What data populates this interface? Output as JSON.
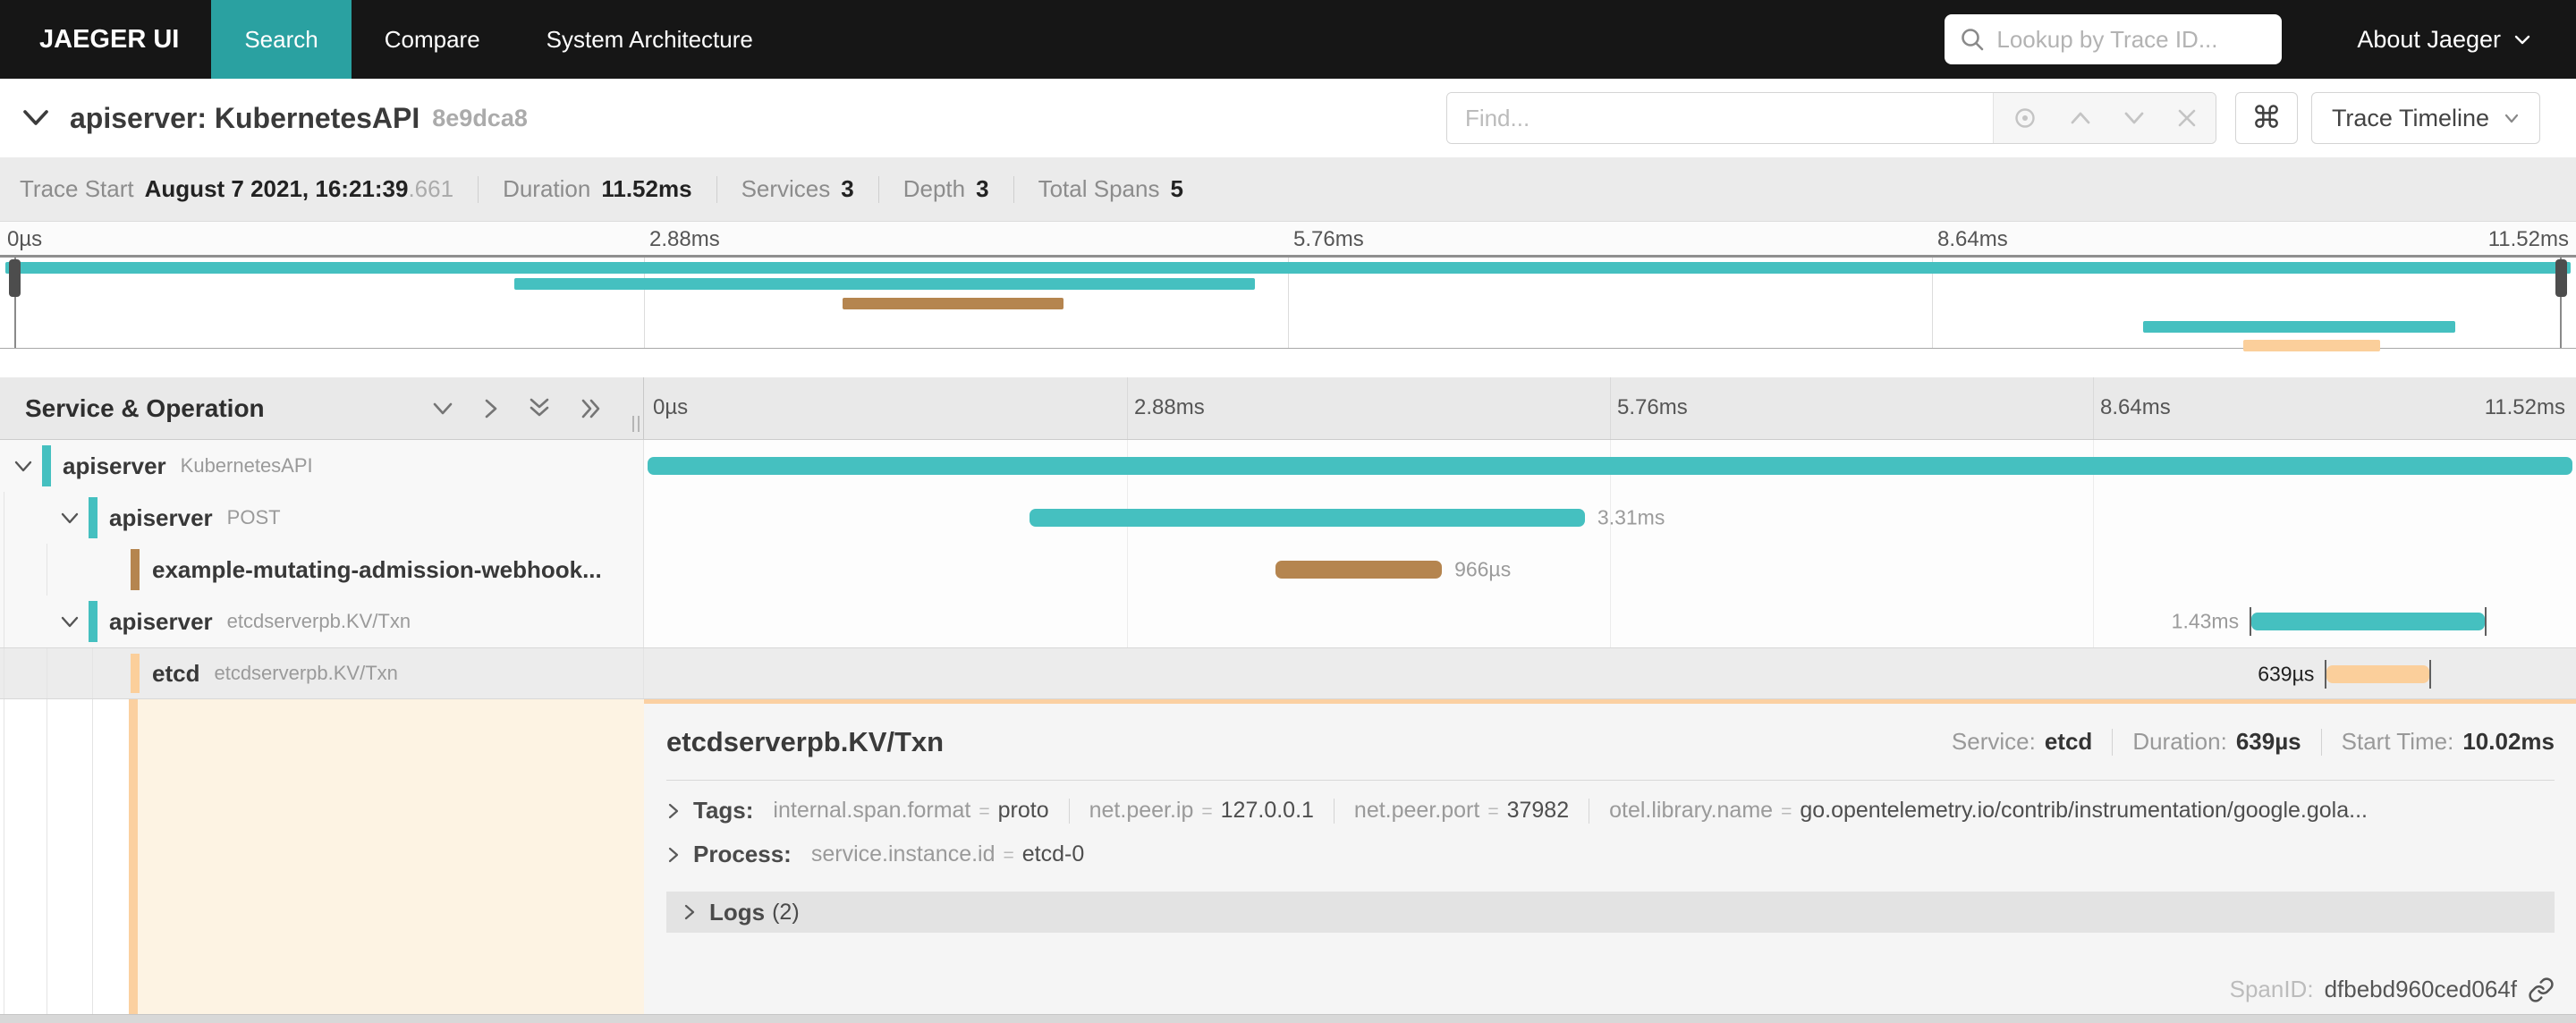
{
  "icons": {
    "command": "⌘"
  },
  "colors": {
    "navbar_bg": "#161616",
    "brand_active_teal": "#2aa1a1",
    "span_teal": "#45c0c0",
    "span_brown": "#b5854f",
    "span_orange": "#fbcf9b",
    "detail_highlight": "#fdf3e3",
    "detail_border_orange": "#fbd0a2"
  },
  "navbar": {
    "brand": "JAEGER UI",
    "items": [
      {
        "label": "Search"
      },
      {
        "label": "Compare"
      },
      {
        "label": "System Architecture"
      }
    ],
    "lookup_placeholder": "Lookup by Trace ID...",
    "about_label": "About Jaeger"
  },
  "trace_header": {
    "title": "apiserver: KubernetesAPI",
    "trace_id": "8e9dca8",
    "find_placeholder": "Find...",
    "view_label": "Trace Timeline"
  },
  "summary": {
    "items": [
      {
        "label": "Trace Start",
        "value": "August 7 2021, 16:21:39",
        "suffix": ".661"
      },
      {
        "label": "Duration",
        "value": "11.52ms",
        "suffix": ""
      },
      {
        "label": "Services",
        "value": "3",
        "suffix": ""
      },
      {
        "label": "Depth",
        "value": "3",
        "suffix": ""
      },
      {
        "label": "Total Spans",
        "value": "5",
        "suffix": ""
      }
    ]
  },
  "minimap": {
    "bars": [
      {
        "left": "0.2%",
        "width": "99.6%",
        "color": "#45c0c0"
      },
      {
        "left": "19.95%",
        "width": "28.75%",
        "color": "#45c0c0"
      },
      {
        "left": "32.7%",
        "width": "8.6%",
        "color": "#b5854f"
      },
      {
        "left": "83.2%",
        "width": "12.1%",
        "color": "#45c0c0"
      },
      {
        "left": "87.1%",
        "width": "5.3%",
        "color": "#fbcf9b"
      }
    ]
  },
  "timeline": {
    "header_title": "Service & Operation",
    "ticks": [
      "0µs",
      "2.88ms",
      "5.76ms",
      "8.64ms",
      "11.52ms"
    ],
    "rows": [
      {
        "service": "apiserver",
        "operation": "KubernetesAPI",
        "duration_label": "",
        "bar": {
          "left": "0.2%",
          "width": "99.6%",
          "color": "#45c0c0"
        }
      },
      {
        "service": "apiserver",
        "operation": "POST",
        "duration_label": "3.31ms",
        "bar": {
          "left": "19.95%",
          "width": "28.75%",
          "color": "#45c0c0"
        }
      },
      {
        "service": "example-mutating-admission-webhook...",
        "operation": "",
        "duration_label": "966µs",
        "bar": {
          "left": "32.7%",
          "width": "8.6%",
          "color": "#b5854f"
        }
      },
      {
        "service": "apiserver",
        "operation": "etcdserverpb.KV/Txn",
        "duration_label": "1.43ms",
        "bar": {
          "left": "83.2%",
          "width": "12.1%",
          "color": "#45c0c0"
        }
      },
      {
        "service": "etcd",
        "operation": "etcdserverpb.KV/Txn",
        "duration_label": "639µs",
        "bar": {
          "left": "87.1%",
          "width": "5.3%",
          "color": "#fbcf9b"
        }
      }
    ]
  },
  "detail": {
    "title": "etcdserverpb.KV/Txn",
    "equals_sign": "=",
    "meta": [
      {
        "label": "Service:",
        "value": "etcd"
      },
      {
        "label": "Duration:",
        "value": "639µs"
      },
      {
        "label": "Start Time:",
        "value": "10.02ms"
      }
    ],
    "tags_label": "Tags:",
    "tags": [
      {
        "key": "internal.span.format",
        "value": "proto"
      },
      {
        "key": "net.peer.ip",
        "value": "127.0.0.1"
      },
      {
        "key": "net.peer.port",
        "value": "37982"
      },
      {
        "key": "otel.library.name",
        "value": "go.opentelemetry.io/contrib/instrumentation/google.gola..."
      }
    ],
    "process_label": "Process:",
    "process_tags": [
      {
        "key": "service.instance.id",
        "value": "etcd-0"
      }
    ],
    "logs_label": "Logs",
    "logs_count": "(2)",
    "spanid_label": "SpanID:",
    "spanid_value": "dfbebd960ced064f"
  }
}
